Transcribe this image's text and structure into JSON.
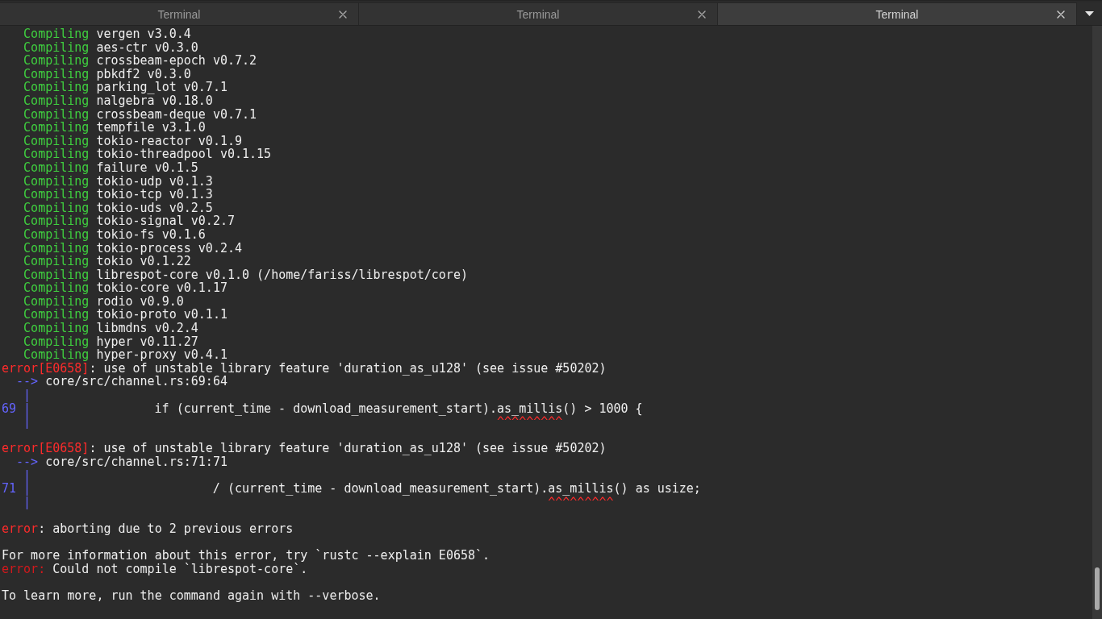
{
  "tabs": [
    {
      "title": "Terminal",
      "selected": false
    },
    {
      "title": "Terminal",
      "selected": false
    },
    {
      "title": "Terminal",
      "selected": true
    }
  ],
  "terminal": {
    "lines": [
      {
        "kind": "compiling",
        "status": "Compiling",
        "text": "vergen v3.0.4"
      },
      {
        "kind": "compiling",
        "status": "Compiling",
        "text": "aes-ctr v0.3.0"
      },
      {
        "kind": "compiling",
        "status": "Compiling",
        "text": "crossbeam-epoch v0.7.2"
      },
      {
        "kind": "compiling",
        "status": "Compiling",
        "text": "pbkdf2 v0.3.0"
      },
      {
        "kind": "compiling",
        "status": "Compiling",
        "text": "parking_lot v0.7.1"
      },
      {
        "kind": "compiling",
        "status": "Compiling",
        "text": "nalgebra v0.18.0"
      },
      {
        "kind": "compiling",
        "status": "Compiling",
        "text": "crossbeam-deque v0.7.1"
      },
      {
        "kind": "compiling",
        "status": "Compiling",
        "text": "tempfile v3.1.0"
      },
      {
        "kind": "compiling",
        "status": "Compiling",
        "text": "tokio-reactor v0.1.9"
      },
      {
        "kind": "compiling",
        "status": "Compiling",
        "text": "tokio-threadpool v0.1.15"
      },
      {
        "kind": "compiling",
        "status": "Compiling",
        "text": "failure v0.1.5"
      },
      {
        "kind": "compiling",
        "status": "Compiling",
        "text": "tokio-udp v0.1.3"
      },
      {
        "kind": "compiling",
        "status": "Compiling",
        "text": "tokio-tcp v0.1.3"
      },
      {
        "kind": "compiling",
        "status": "Compiling",
        "text": "tokio-uds v0.2.5"
      },
      {
        "kind": "compiling",
        "status": "Compiling",
        "text": "tokio-signal v0.2.7"
      },
      {
        "kind": "compiling",
        "status": "Compiling",
        "text": "tokio-fs v0.1.6"
      },
      {
        "kind": "compiling",
        "status": "Compiling",
        "text": "tokio-process v0.2.4"
      },
      {
        "kind": "compiling",
        "status": "Compiling",
        "text": "tokio v0.1.22"
      },
      {
        "kind": "compiling",
        "status": "Compiling",
        "text": "librespot-core v0.1.0 (/home/fariss/librespot/core)"
      },
      {
        "kind": "compiling",
        "status": "Compiling",
        "text": "tokio-core v0.1.17"
      },
      {
        "kind": "compiling",
        "status": "Compiling",
        "text": "rodio v0.9.0"
      },
      {
        "kind": "compiling",
        "status": "Compiling",
        "text": "tokio-proto v0.1.1"
      },
      {
        "kind": "compiling",
        "status": "Compiling",
        "text": "libmdns v0.2.4"
      },
      {
        "kind": "compiling",
        "status": "Compiling",
        "text": "hyper v0.11.27"
      },
      {
        "kind": "compiling",
        "status": "Compiling",
        "text": "hyper-proxy v0.4.1"
      },
      {
        "kind": "error",
        "label": "error[E0658]",
        "text": ": use of unstable library feature 'duration_as_u128' (see issue #50202)"
      },
      {
        "kind": "location",
        "arrow": "-->",
        "text": "core/src/channel.rs:69:64"
      },
      {
        "kind": "gutter",
        "bar": "|"
      },
      {
        "kind": "code",
        "line_number": "69",
        "bar": "|",
        "text": "                if (current_time - download_measurement_start).as_millis() > 1000 {"
      },
      {
        "kind": "marker",
        "bar": "|",
        "text": "                                                               ^^^^^^^^^"
      },
      {
        "kind": "blank"
      },
      {
        "kind": "error",
        "label": "error[E0658]",
        "text": ": use of unstable library feature 'duration_as_u128' (see issue #50202)"
      },
      {
        "kind": "location",
        "arrow": "-->",
        "text": "core/src/channel.rs:71:71"
      },
      {
        "kind": "gutter",
        "bar": "|"
      },
      {
        "kind": "code",
        "line_number": "71",
        "bar": "|",
        "text": "                        / (current_time - download_measurement_start).as_millis() as usize;"
      },
      {
        "kind": "marker",
        "bar": "|",
        "text": "                                                                      ^^^^^^^^^"
      },
      {
        "kind": "blank"
      },
      {
        "kind": "error",
        "label": "error",
        "text": ": aborting due to 2 previous errors"
      },
      {
        "kind": "blank"
      },
      {
        "kind": "plain",
        "text": "For more information about this error, try `rustc --explain E0658`."
      },
      {
        "kind": "cargo_error",
        "label": "error:",
        "text": "Could not compile `librespot-core`."
      },
      {
        "kind": "blank"
      },
      {
        "kind": "plain",
        "text": "To learn more, run the command again with --verbose."
      }
    ]
  }
}
